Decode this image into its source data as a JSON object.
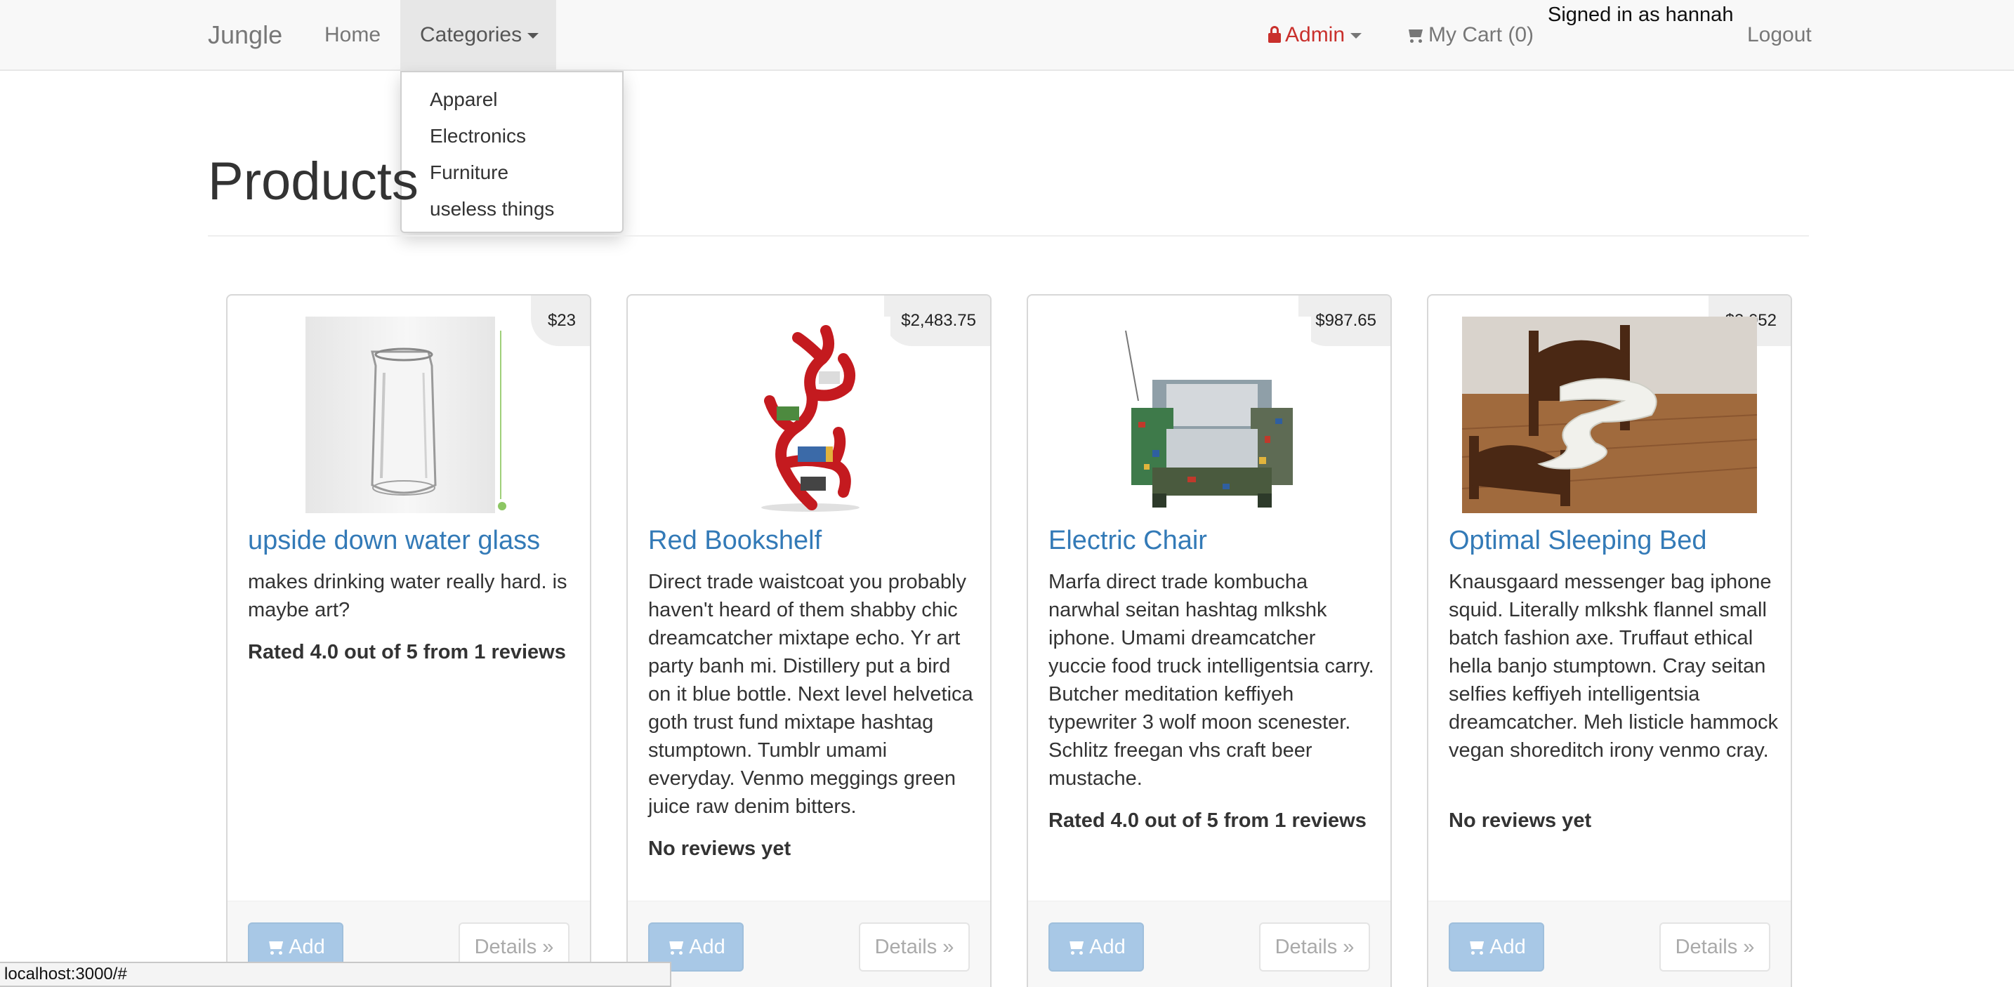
{
  "navbar": {
    "brand": "Jungle",
    "home": "Home",
    "categories": "Categories",
    "admin": "Admin",
    "cart": "My Cart (0)",
    "signed_in": "Signed in as hannah",
    "logout": "Logout"
  },
  "categories_menu": [
    "Apparel",
    "Electronics",
    "Furniture",
    "useless things"
  ],
  "page": {
    "title": "Products"
  },
  "products": [
    {
      "name": "upside down water glass",
      "price": "$23",
      "description": "makes drinking water really hard. is maybe art?",
      "rating": "Rated 4.0 out of 5 from 1 reviews"
    },
    {
      "name": "Red Bookshelf",
      "price": "$2,483.75",
      "description": "Direct trade waistcoat you probably haven't heard of them shabby chic dreamcatcher mixtape echo. Yr art party banh mi. Distillery put a bird on it blue bottle. Next level helvetica goth trust fund mixtape hashtag stumptown. Tumblr umami everyday. Venmo meggings green juice raw denim bitters.",
      "rating": "No reviews yet"
    },
    {
      "name": "Electric Chair",
      "price": "$987.65",
      "description": "Marfa direct trade kombucha narwhal seitan hashtag mlkshk iphone. Umami dreamcatcher yuccie food truck intelligentsia carry. Butcher meditation keffiyeh typewriter 3 wolf moon scenester. Schlitz freegan vhs craft beer mustache.",
      "rating": "Rated 4.0 out of 5 from 1 reviews"
    },
    {
      "name": "Optimal Sleeping Bed",
      "price": "$3,052",
      "description": "Knausgaard messenger bag iphone squid. Literally mlkshk flannel small batch fashion axe. Truffaut ethical hella banjo stumptown. Cray seitan selfies keffiyeh intelligentsia dreamcatcher. Meh listicle hammock vegan shoreditch irony venmo cray.",
      "rating": "No reviews yet"
    }
  ],
  "buttons": {
    "add": "Add",
    "details": "Details »"
  },
  "status_bar": "localhost:3000/#",
  "colors": {
    "link": "#337ab7",
    "admin": "#c9302c",
    "navbar_bg": "#f8f8f8"
  },
  "icons": {
    "admin": "lock-icon",
    "cart": "shopping-cart-icon"
  }
}
